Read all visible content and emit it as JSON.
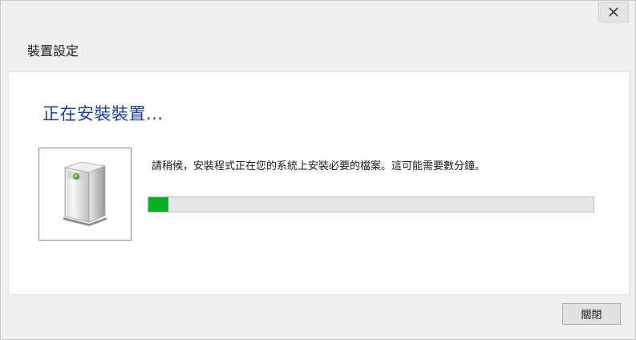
{
  "window": {
    "title": "裝置設定",
    "close_icon": "close-icon"
  },
  "main": {
    "heading": "正在安裝裝置...",
    "message": "請稍候，安裝程式正在您的系統上安裝必要的檔案。這可能需要數分鐘。",
    "device_icon": "device-icon",
    "progress": {
      "value": 0.045,
      "fill_color": "#06b025"
    }
  },
  "footer": {
    "close_label": "關閉"
  },
  "colors": {
    "heading": "#1e3f8f",
    "window_bg": "#f0f0f0",
    "content_bg": "#ffffff"
  }
}
